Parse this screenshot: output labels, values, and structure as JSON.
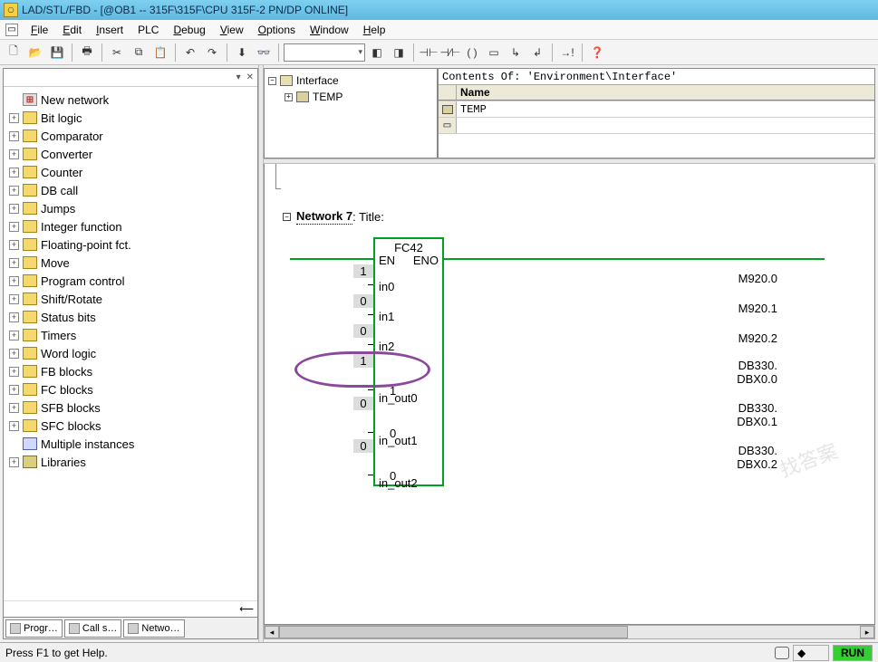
{
  "title": "LAD/STL/FBD  - [@OB1 -- 315F\\315F\\CPU 315F-2 PN/DP  ONLINE]",
  "menu": {
    "file": "File",
    "edit": "Edit",
    "insert": "Insert",
    "plc": "PLC",
    "debug": "Debug",
    "view": "View",
    "options": "Options",
    "window": "Window",
    "help": "Help"
  },
  "tree": [
    {
      "pm": "",
      "icon": "net",
      "label": "New network"
    },
    {
      "pm": "+",
      "icon": "folder",
      "label": "Bit logic"
    },
    {
      "pm": "+",
      "icon": "folder",
      "label": "Comparator"
    },
    {
      "pm": "+",
      "icon": "folder",
      "label": "Converter"
    },
    {
      "pm": "+",
      "icon": "folder",
      "label": "Counter"
    },
    {
      "pm": "+",
      "icon": "folder",
      "label": "DB call"
    },
    {
      "pm": "+",
      "icon": "folder",
      "label": "Jumps"
    },
    {
      "pm": "+",
      "icon": "folder",
      "label": "Integer function"
    },
    {
      "pm": "+",
      "icon": "folder",
      "label": "Floating-point fct."
    },
    {
      "pm": "+",
      "icon": "folder",
      "label": "Move"
    },
    {
      "pm": "+",
      "icon": "folder",
      "label": "Program control"
    },
    {
      "pm": "+",
      "icon": "folder",
      "label": "Shift/Rotate"
    },
    {
      "pm": "+",
      "icon": "folder",
      "label": "Status bits"
    },
    {
      "pm": "+",
      "icon": "folder",
      "label": "Timers"
    },
    {
      "pm": "+",
      "icon": "folder",
      "label": "Word logic"
    },
    {
      "pm": "+",
      "icon": "folder",
      "label": "FB blocks"
    },
    {
      "pm": "+",
      "icon": "folder",
      "label": "FC blocks"
    },
    {
      "pm": "+",
      "icon": "folder",
      "label": "SFB blocks"
    },
    {
      "pm": "+",
      "icon": "folder",
      "label": "SFC blocks"
    },
    {
      "pm": "",
      "icon": "blue",
      "label": "Multiple instances"
    },
    {
      "pm": "+",
      "icon": "books",
      "label": "Libraries"
    }
  ],
  "lp_tabs": {
    "t1": "Progr…",
    "t2": "Call s…",
    "t3": "Netwo…"
  },
  "iface": {
    "root": "Interface",
    "temp": "TEMP",
    "contents_title": "Contents Of: 'Environment\\Interface'",
    "name_col": "Name",
    "rows": [
      "TEMP"
    ]
  },
  "network": {
    "label": "Network 7",
    "title_word": ": Title:"
  },
  "block": {
    "name": "FC42",
    "en": "EN",
    "eno": "ENO",
    "ports_in": [
      "in0",
      "in1",
      "in2",
      "in_out0",
      "in_out1",
      "in_out2"
    ],
    "inner_vals": [
      "1",
      "0",
      "0"
    ],
    "left_labels_single": [
      "M920.0",
      "M920.1",
      "M920.2"
    ],
    "left_labels_double": [
      {
        "a": "DB330.",
        "b": "DBX0.0"
      },
      {
        "a": "DB330.",
        "b": "DBX0.1"
      },
      {
        "a": "DB330.",
        "b": "DBX0.2"
      }
    ],
    "left_vals": [
      "1",
      "0",
      "0",
      "1",
      "0",
      "0"
    ]
  },
  "status": {
    "help": "Press F1 to get Help.",
    "run": "RUN"
  },
  "watermark": "找答案"
}
